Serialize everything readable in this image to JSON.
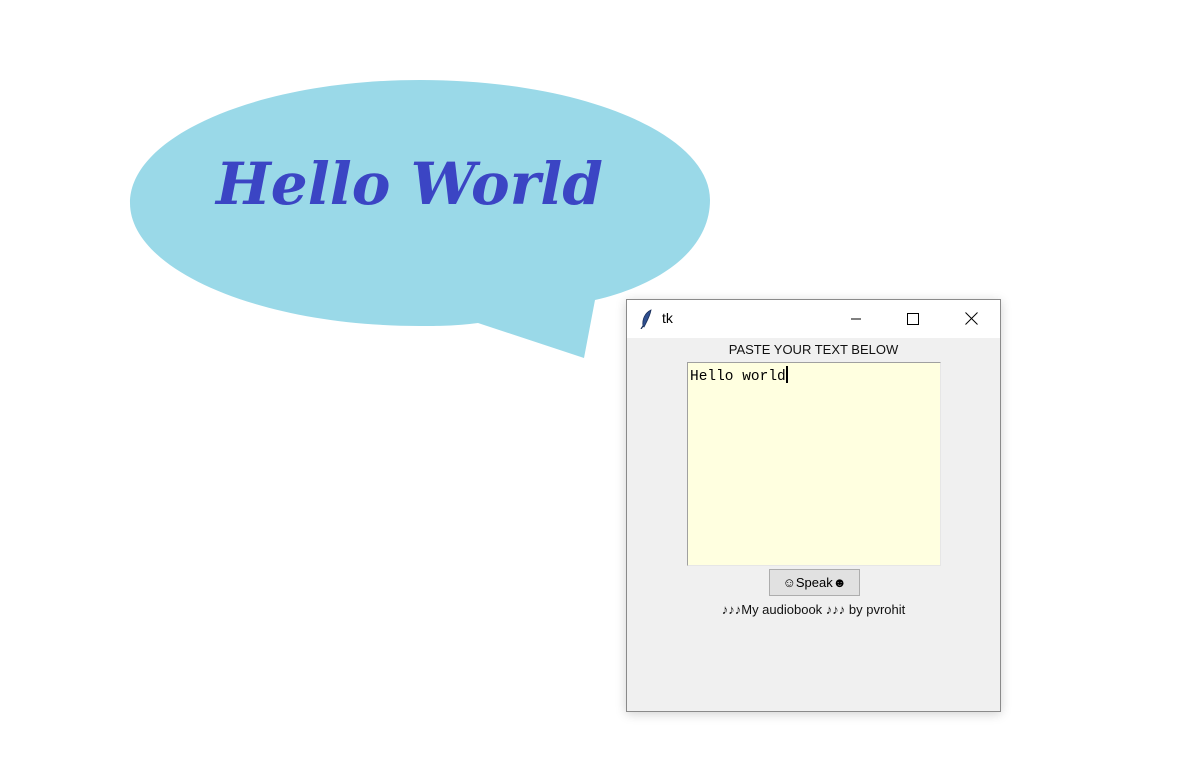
{
  "bubble": {
    "text": "Hello World",
    "fill_color": "#9ad9e8",
    "text_color": "#3b45c4"
  },
  "window": {
    "title": "tk",
    "app_icon": "feather-icon",
    "controls": {
      "minimize": "minimize-icon",
      "maximize": "maximize-icon",
      "close": "close-icon"
    }
  },
  "main": {
    "instruction_label": "PASTE YOUR TEXT BELOW",
    "text_input_value": "Hello world",
    "text_input_bg": "#ffffe0",
    "speak_button_label": "☺Speak☻",
    "footer_label": "♪♪♪My audiobook ♪♪♪ by pvrohit"
  }
}
